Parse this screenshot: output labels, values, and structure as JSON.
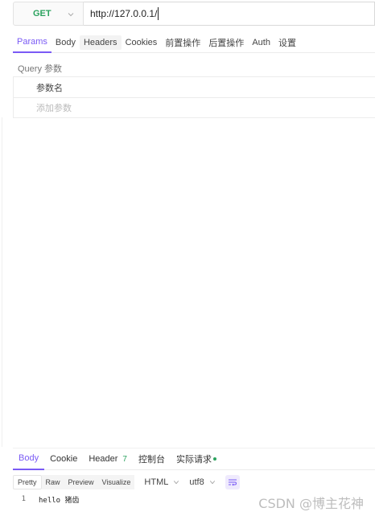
{
  "request": {
    "method": "GET",
    "url": "http://127.0.0.1/"
  },
  "request_tabs": [
    {
      "label": "Params",
      "active": true
    },
    {
      "label": "Body"
    },
    {
      "label": "Headers",
      "hover": true
    },
    {
      "label": "Cookies"
    },
    {
      "label": "前置操作"
    },
    {
      "label": "后置操作"
    },
    {
      "label": "Auth"
    },
    {
      "label": "设置"
    }
  ],
  "params": {
    "section_label": "Query 参数",
    "column_header": "参数名",
    "add_placeholder": "添加参数"
  },
  "response_tabs": {
    "body": "Body",
    "cookie": "Cookie",
    "header": "Header",
    "header_count": "7",
    "console": "控制台",
    "actual_request": "实际请求"
  },
  "response_toolbar": {
    "views": [
      "Pretty",
      "Raw",
      "Preview",
      "Visualize"
    ],
    "format": "HTML",
    "encoding": "utf8"
  },
  "response_body": {
    "line_number": "1",
    "text": "hello 猪齿"
  },
  "watermark": "CSDN @博主花神",
  "colors": {
    "accent": "#7a5af5",
    "method_green": "#2ca35f"
  }
}
